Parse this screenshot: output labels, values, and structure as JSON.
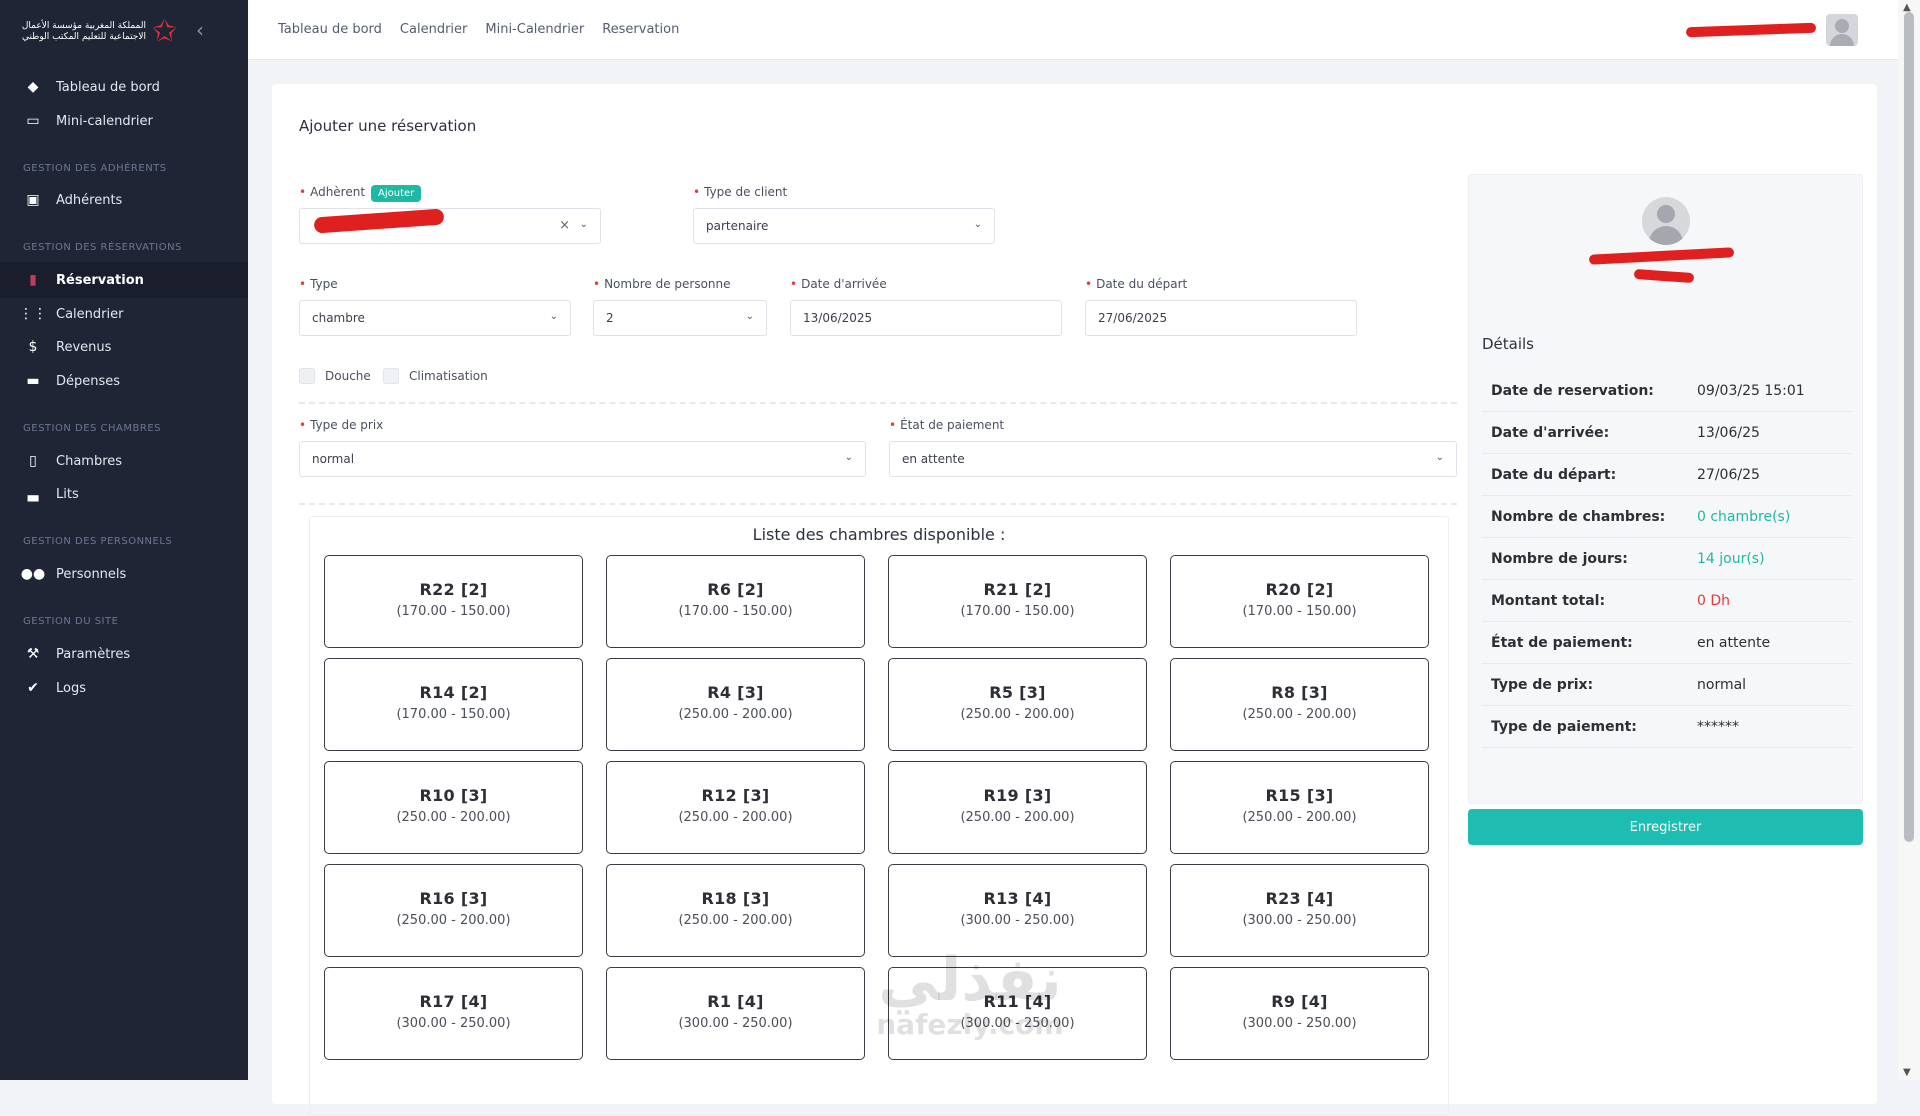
{
  "brand": {
    "logo_text": "المملكة المغربية مؤسسة الأعمال الاجتماعية للتعليم المكتب الوطني"
  },
  "sidebar": {
    "items": [
      {
        "label": "Tableau de bord",
        "icon": "dashboard-icon"
      },
      {
        "label": "Mini-calendrier",
        "icon": "mini-calendar-icon"
      },
      {
        "section": "GESTION DES ADHÉRENTS"
      },
      {
        "label": "Adhérents",
        "icon": "member-card-icon"
      },
      {
        "section": "GESTION DES RÉSERVATIONS"
      },
      {
        "label": "Réservation",
        "icon": "reservation-icon",
        "active": true
      },
      {
        "label": "Calendrier",
        "icon": "calendar-icon"
      },
      {
        "label": "Revenus",
        "icon": "dollar-icon"
      },
      {
        "label": "Dépenses",
        "icon": "credit-card-icon"
      },
      {
        "section": "GESTION DES CHAMBRES"
      },
      {
        "label": "Chambres",
        "icon": "door-icon"
      },
      {
        "label": "Lits",
        "icon": "bed-icon"
      },
      {
        "section": "GESTION DES PERSONNELS"
      },
      {
        "label": "Personnels",
        "icon": "people-icon"
      },
      {
        "section": "GESTION DU SITE"
      },
      {
        "label": "Paramètres",
        "icon": "wrench-icon"
      },
      {
        "label": "Logs",
        "icon": "check-circle-icon"
      }
    ]
  },
  "topbar": {
    "links": [
      "Tableau de bord",
      "Calendrier",
      "Mini-Calendrier",
      "Reservation"
    ]
  },
  "form": {
    "title": "Ajouter une réservation",
    "adherent": {
      "label": "Adhèrent",
      "badge": "Ajouter"
    },
    "type_client": {
      "label": "Type de client",
      "value": "partenaire"
    },
    "type": {
      "label": "Type",
      "value": "chambre"
    },
    "nombre": {
      "label": "Nombre de personne",
      "value": "2"
    },
    "arrivee": {
      "label": "Date d'arrivée",
      "value": "13/06/2025"
    },
    "depart": {
      "label": "Date du départ",
      "value": "27/06/2025"
    },
    "douche": "Douche",
    "climatisation": "Climatisation",
    "type_prix": {
      "label": "Type de prix",
      "value": "normal"
    },
    "etat_paiement": {
      "label": "État de paiement",
      "value": "en attente"
    }
  },
  "rooms": {
    "title": "Liste des chambres disponible :",
    "list": [
      {
        "name": "R22 [2]",
        "price": "(170.00 - 150.00)"
      },
      {
        "name": "R6 [2]",
        "price": "(170.00 - 150.00)"
      },
      {
        "name": "R21 [2]",
        "price": "(170.00 - 150.00)"
      },
      {
        "name": "R20 [2]",
        "price": "(170.00 - 150.00)"
      },
      {
        "name": "R14 [2]",
        "price": "(170.00 - 150.00)"
      },
      {
        "name": "R4 [3]",
        "price": "(250.00 - 200.00)"
      },
      {
        "name": "R5 [3]",
        "price": "(250.00 - 200.00)"
      },
      {
        "name": "R8 [3]",
        "price": "(250.00 - 200.00)"
      },
      {
        "name": "R10 [3]",
        "price": "(250.00 - 200.00)"
      },
      {
        "name": "R12 [3]",
        "price": "(250.00 - 200.00)"
      },
      {
        "name": "R19 [3]",
        "price": "(250.00 - 200.00)"
      },
      {
        "name": "R15 [3]",
        "price": "(250.00 - 200.00)"
      },
      {
        "name": "R16 [3]",
        "price": "(250.00 - 200.00)"
      },
      {
        "name": "R18 [3]",
        "price": "(250.00 - 200.00)"
      },
      {
        "name": "R13 [4]",
        "price": "(300.00 - 250.00)"
      },
      {
        "name": "R23 [4]",
        "price": "(300.00 - 250.00)"
      },
      {
        "name": "R17 [4]",
        "price": "(300.00 - 250.00)"
      },
      {
        "name": "R1 [4]",
        "price": "(300.00 - 250.00)"
      },
      {
        "name": "R11 [4]",
        "price": "(300.00 - 250.00)"
      },
      {
        "name": "R9 [4]",
        "price": "(300.00 - 250.00)"
      }
    ]
  },
  "details": {
    "title": "Détails",
    "rows": [
      {
        "k": "Date de reservation:",
        "v": "09/03/25 15:01",
        "style": ""
      },
      {
        "k": "Date d'arrivée:",
        "v": "13/06/25",
        "style": ""
      },
      {
        "k": "Date du départ:",
        "v": "27/06/25",
        "style": ""
      },
      {
        "k": "Nombre de chambres:",
        "v": "0 chambre(s)",
        "style": "teal"
      },
      {
        "k": "Nombre de jours:",
        "v": "14 jour(s)",
        "style": "teal"
      },
      {
        "k": "Montant total:",
        "v": "0 Dh",
        "style": "red"
      },
      {
        "k": "État de paiement:",
        "v": "en attente",
        "style": ""
      },
      {
        "k": "Type de prix:",
        "v": "normal",
        "style": ""
      },
      {
        "k": "Type de paiement:",
        "v": "******",
        "style": ""
      }
    ]
  },
  "save_label": "Enregistrer",
  "watermark": {
    "text": "نفذلي",
    "url": "nafezly.com"
  },
  "colors": {
    "accent": "#1fbcb2",
    "sidebar": "#202536",
    "required": "#e13b3b"
  }
}
